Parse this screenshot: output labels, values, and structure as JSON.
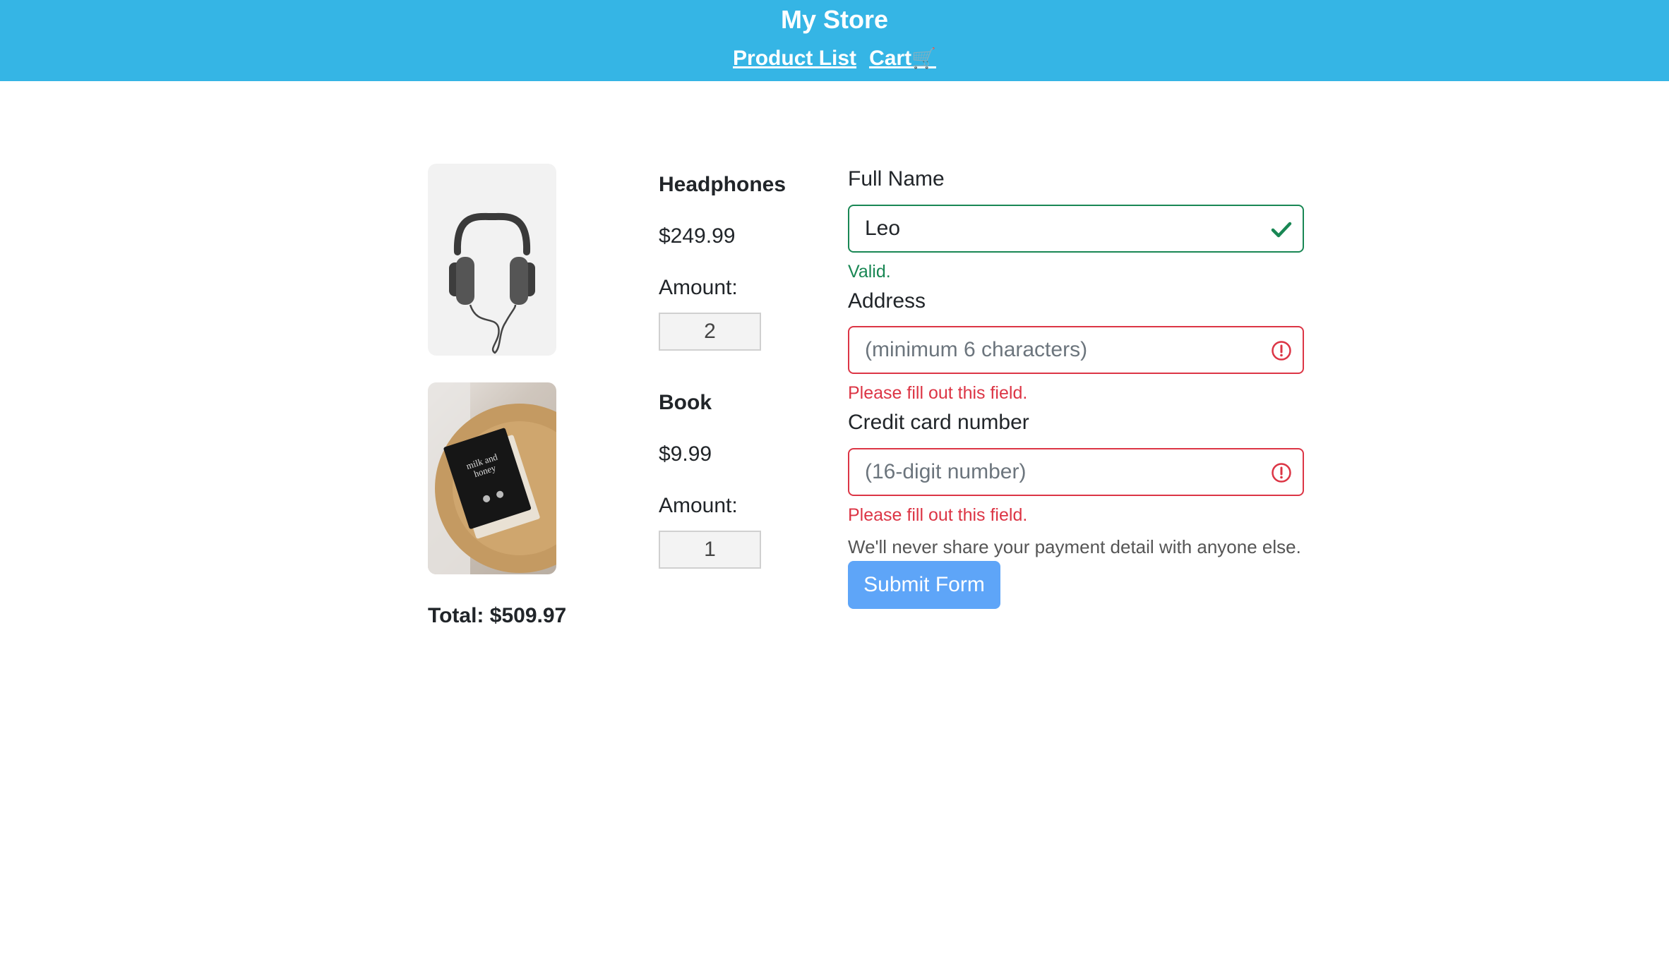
{
  "header": {
    "title": "My Store",
    "nav": {
      "product_list": "Product List",
      "cart": "Cart",
      "cart_icon": "🛒"
    }
  },
  "cart": {
    "items": [
      {
        "name": "Headphones",
        "price": "$249.99",
        "amount_label": "Amount:",
        "amount": "2",
        "image_icon": "headphones-image"
      },
      {
        "name": "Book",
        "price": "$9.99",
        "amount_label": "Amount:",
        "amount": "1",
        "image_icon": "book-image"
      }
    ],
    "total": "Total: $509.97"
  },
  "form": {
    "full_name": {
      "label": "Full Name",
      "value": "Leo",
      "feedback": "Valid.",
      "state": "valid"
    },
    "address": {
      "label": "Address",
      "placeholder": "(minimum 6 characters)",
      "feedback": "Please fill out this field.",
      "state": "invalid"
    },
    "credit_card": {
      "label": "Credit card number",
      "placeholder": "(16-digit number)",
      "feedback": "Please fill out this field.",
      "state": "invalid"
    },
    "help_text": "We'll never share your payment detail with anyone else.",
    "submit_label": "Submit Form"
  },
  "colors": {
    "header_bg": "#35b5e5",
    "valid": "#198754",
    "invalid": "#dc3545",
    "button": "#5ea5f8"
  }
}
